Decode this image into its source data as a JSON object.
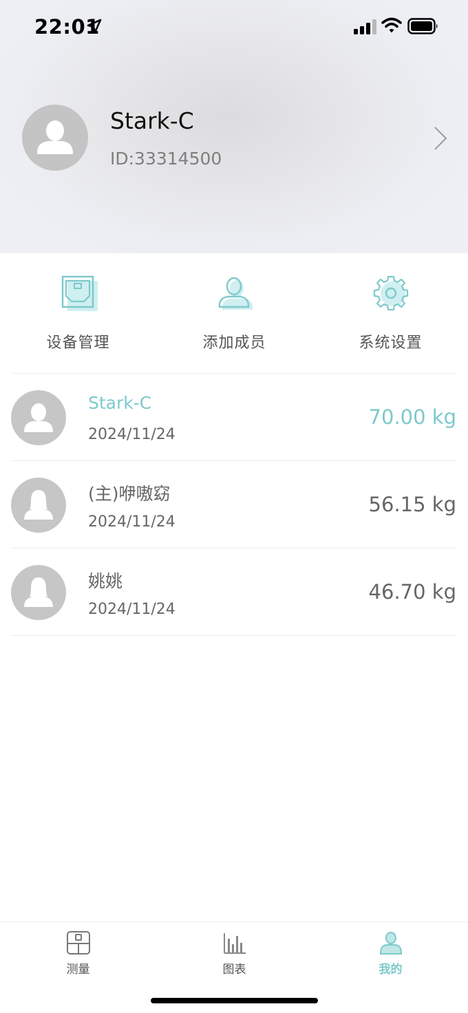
{
  "status_bar": {
    "time": "22:01"
  },
  "profile": {
    "name": "Stark-C",
    "id_text": "ID:33314500"
  },
  "menu": [
    {
      "label": "设备管理",
      "icon": "device-management-icon"
    },
    {
      "label": "添加成员",
      "icon": "add-member-icon"
    },
    {
      "label": "系统设置",
      "icon": "gear-icon"
    }
  ],
  "members": [
    {
      "name": "Stark-C",
      "date": "2024/11/24",
      "weight": "70.00 kg",
      "selected": true
    },
    {
      "name": "(主)咿嗷窈",
      "date": "2024/11/24",
      "weight": "56.15 kg",
      "selected": false
    },
    {
      "name": "姚姚",
      "date": "2024/11/24",
      "weight": "46.70 kg",
      "selected": false
    }
  ],
  "tabs": [
    {
      "label": "测量",
      "icon": "scale-icon"
    },
    {
      "label": "图表",
      "icon": "bar-chart-icon"
    },
    {
      "label": "我的",
      "icon": "person-icon",
      "active": true
    }
  ],
  "colors": {
    "accent": "#7ec9cc",
    "avatar_bg": "#c4c4c4",
    "text_gray": "#666666"
  }
}
